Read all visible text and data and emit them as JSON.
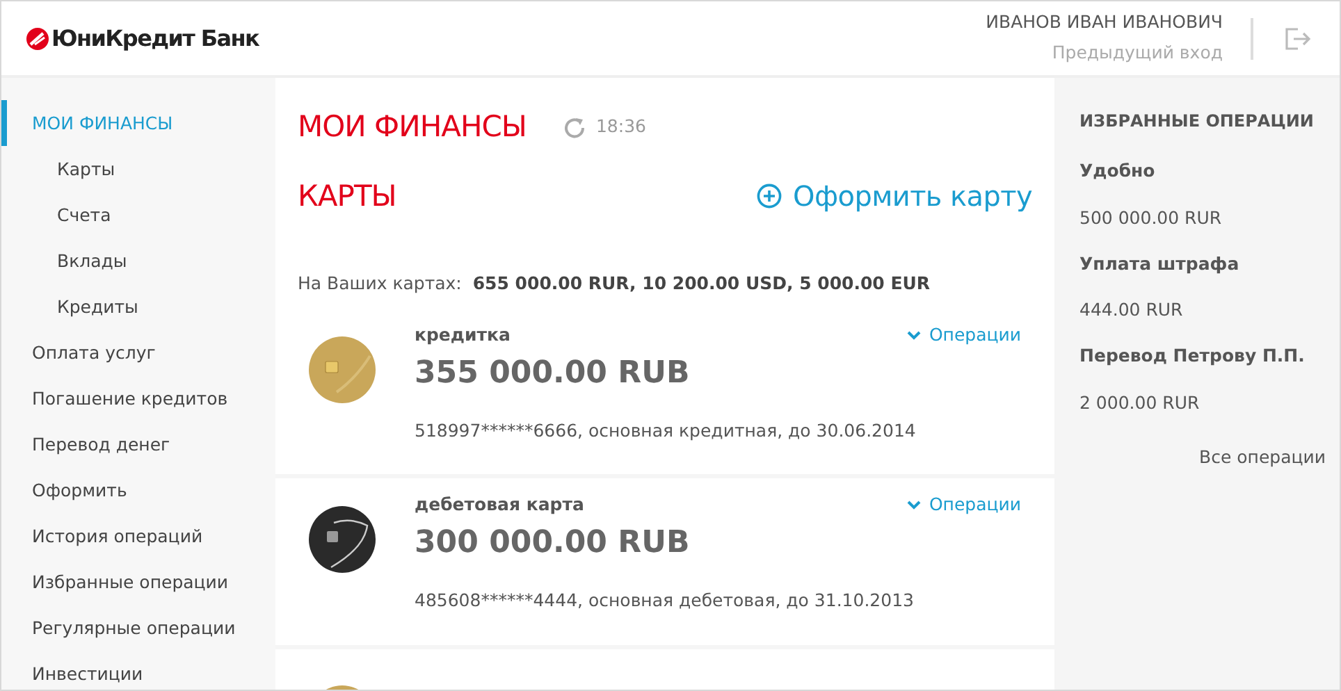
{
  "header": {
    "logo": "ЮниКредит Банк",
    "user_name": "ИВАНОВ ИВАН ИВАНОВИЧ",
    "previous_login": "Предыдущий вход"
  },
  "sidebar": {
    "items": [
      {
        "label": "МОИ ФИНАНСЫ",
        "selected": true,
        "children": [
          {
            "label": "Карты",
            "selected": false
          },
          {
            "label": "Счета",
            "selected": false
          },
          {
            "label": "Вклады",
            "selected": false
          },
          {
            "label": "Кредиты",
            "selected": false
          }
        ]
      },
      {
        "label": "Оплата услуг",
        "selected": false
      },
      {
        "label": "Погашение кредитов",
        "selected": false
      },
      {
        "label": "Перевод денег",
        "selected": false
      },
      {
        "label": "Оформить",
        "selected": false
      },
      {
        "label": "История операций",
        "selected": false
      },
      {
        "label": "Избранные операции",
        "selected": false
      },
      {
        "label": "Регулярные операции",
        "selected": false
      },
      {
        "label": "Инвестиции",
        "selected": false
      }
    ]
  },
  "main": {
    "title": "МОИ ФИНАНСЫ",
    "updated_time": "18:36",
    "section_title": "КАРТЫ",
    "new_card_link": "Оформить карту",
    "summary_label": "На Ваших картах:",
    "summary_value": "655 000.00 RUR, 10 200.00 USD, 5 000.00 EUR",
    "cards": [
      {
        "kind": "gold",
        "name": "кредитка",
        "balance": "355 000.00 RUB",
        "operations_link": "Операции",
        "details": "518997******6666,  основная кредитная, до 30.06.2014"
      },
      {
        "kind": "dark",
        "name": "дебетовая карта",
        "balance": "300 000.00 RUB",
        "operations_link": "Операции",
        "details": "485608******4444,  основная дебетовая, до 31.10.2013"
      }
    ]
  },
  "favorites": {
    "title": "ИЗБРАННЫЕ ОПЕРАЦИИ",
    "items": [
      {
        "name": "Удобно",
        "amount": "500 000.00 RUR"
      },
      {
        "name": "Уплата штрафа",
        "amount": "444.00 RUR"
      },
      {
        "name": "Перевод Петрову П.П.",
        "amount": "2 000.00 RUR"
      }
    ],
    "all_link": "Все операции"
  }
}
